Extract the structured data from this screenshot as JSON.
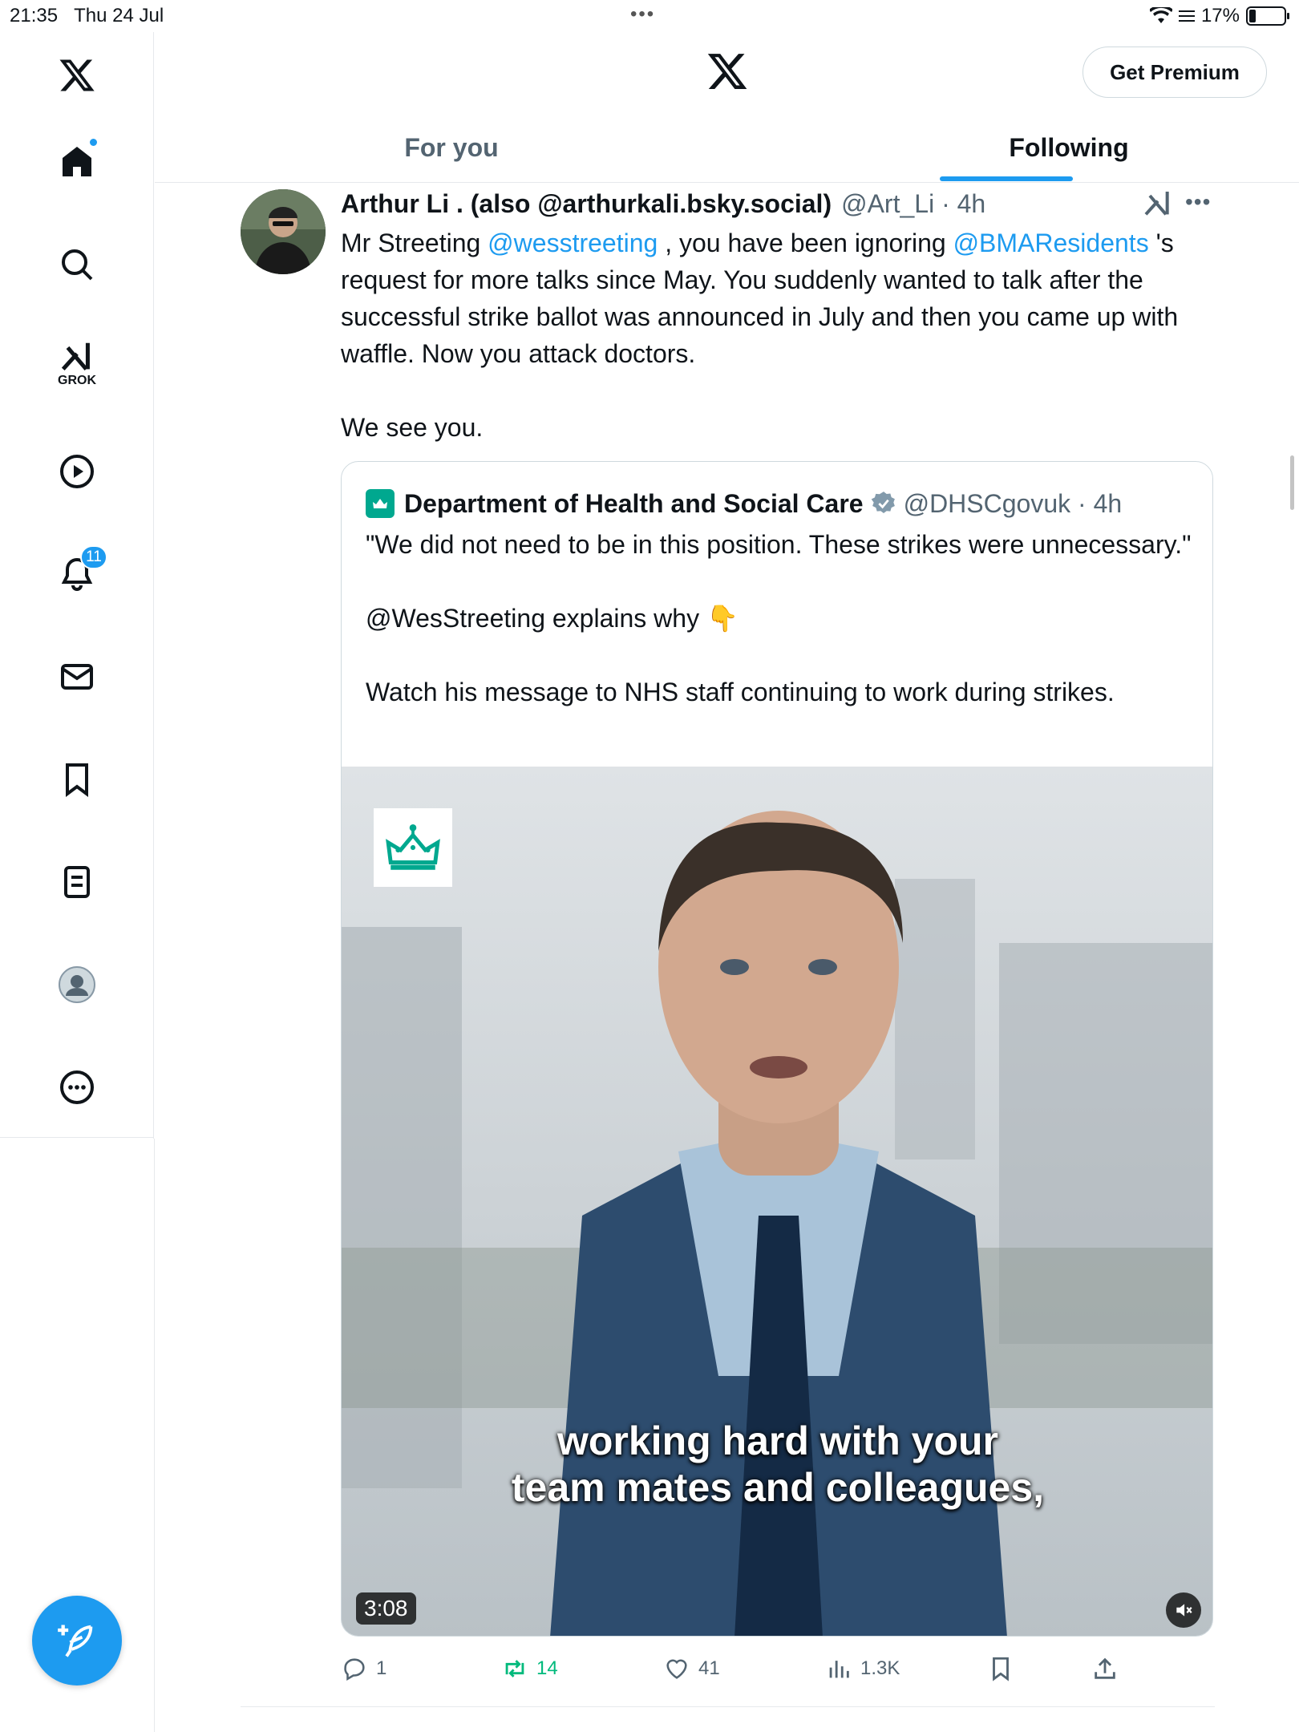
{
  "status_bar": {
    "time": "21:35",
    "date": "Thu 24 Jul",
    "battery": "17%"
  },
  "sidebar": {
    "grok_label": "GROK",
    "notifications_count": "11"
  },
  "header": {
    "premium_label": "Get Premium"
  },
  "tabs": [
    {
      "label": "For you"
    },
    {
      "label": "Following"
    }
  ],
  "tweet": {
    "name": "Arthur Li . (also @arthurkali.bsky.social)",
    "handle_time": "@Art_Li · 4h",
    "text_1": "Mr Streeting ",
    "mention_1": "@wesstreeting",
    "text_2": " , you have been ignoring ",
    "mention_2": "@BMAResidents",
    "text_3": " 's request for more talks since May. You suddenly wanted to talk after the successful strike ballot was announced in July and then you came up with waffle. Now you attack doctors.\n\nWe see you."
  },
  "quote": {
    "name": "Department of Health and Social Care",
    "handle_time": "@DHSCgovuk · 4h",
    "text": "\"We did not need to be in this position. These strikes were unnecessary.\"\n\n@WesStreeting explains why 👇\n\nWatch his message to NHS staff continuing to work during strikes.",
    "video_caption": "working hard with your\nteam mates and colleagues,",
    "video_duration": "3:08"
  },
  "actions": {
    "replies": "1",
    "reposts": "14",
    "likes": "41",
    "views": "1.3K"
  },
  "colors": {
    "accent": "#1d9bf0",
    "repost": "#00ba7c",
    "muted": "#536471",
    "dhsc": "#00a88f"
  }
}
